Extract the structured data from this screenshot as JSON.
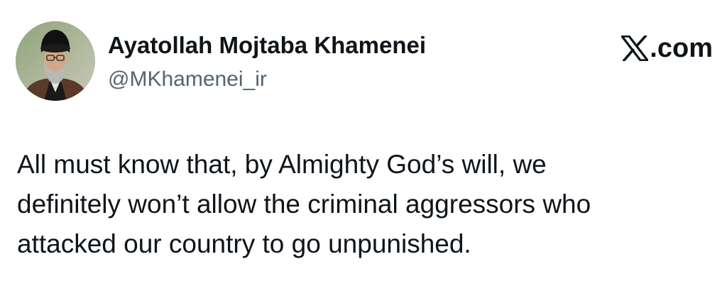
{
  "author": {
    "name": "Ayatollah Mojtaba Khamenei",
    "handle": "@MKhamenei_ir"
  },
  "site": {
    "logo_icon": "x-logo-icon",
    "suffix": ".com"
  },
  "tweet": {
    "lines": [
      "All must know that, by Almighty God’s will, we",
      "definitely won’t allow the criminal aggressors who",
      "attacked our country to go unpunished."
    ]
  },
  "colors": {
    "text": "#0f1419",
    "handle": "#536471",
    "background": "#ffffff"
  }
}
